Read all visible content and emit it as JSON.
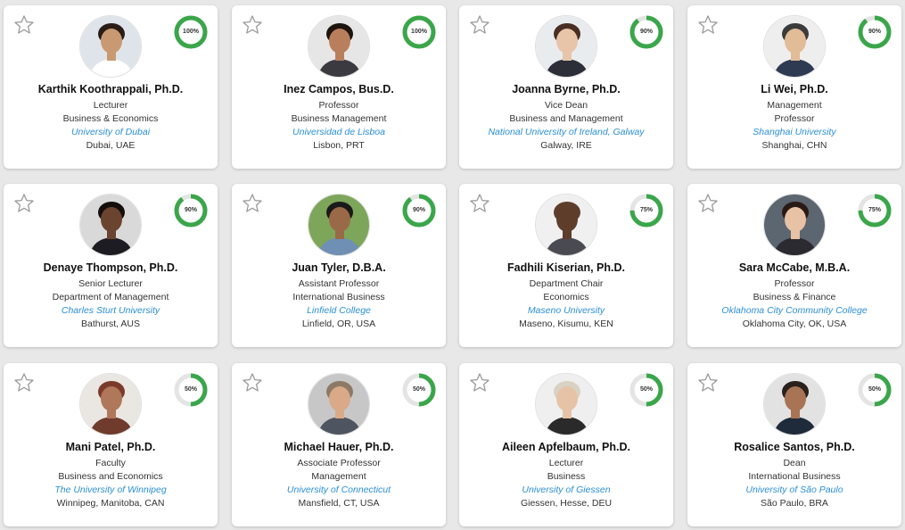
{
  "colors": {
    "ring_fill": "#3aa64a",
    "ring_track": "#e4e4e4",
    "link": "#2b8fd6"
  },
  "cards": [
    {
      "name": "Karthik Koothrappali, Ph.D.",
      "role": "Lecturer",
      "dept": "Business & Economics",
      "university": "University of Dubai",
      "location": "Dubai, UAE",
      "score": "100%",
      "score_value": 100,
      "skin": "#c99a72",
      "hair": "#2a1d16",
      "shirt": "#ffffff",
      "bg": "#dfe4ea"
    },
    {
      "name": "Inez Campos, Bus.D.",
      "role": "Professor",
      "dept": "Business Management",
      "university": "Universidad de Lisboa",
      "location": "Lisbon, PRT",
      "score": "100%",
      "score_value": 100,
      "skin": "#b97f5d",
      "hair": "#1e1410",
      "shirt": "#3a3a40",
      "bg": "#e6e6e6"
    },
    {
      "name": "Joanna Byrne, Ph.D.",
      "role": "Vice Dean",
      "dept": "Business and Management",
      "university": "National University of Ireland, Galway",
      "location": "Galway, IRE",
      "score": "90%",
      "score_value": 90,
      "skin": "#e8c4a8",
      "hair": "#4a2e22",
      "shirt": "#2c2f38",
      "bg": "#e9ecef"
    },
    {
      "name": "Li Wei, Ph.D.",
      "role": "Management",
      "dept": "Professor",
      "university": "Shanghai University",
      "location": "Shanghai, CHN",
      "score": "90%",
      "score_value": 90,
      "skin": "#e2bb97",
      "hair": "#3b3b3b",
      "shirt": "#2e3a52",
      "bg": "#eeeeee"
    },
    {
      "name": "Denaye Thompson, Ph.D.",
      "role": "Senior Lecturer",
      "dept": "Department of Management",
      "university": "Charles Sturt University",
      "location": "Bathurst, AUS",
      "score": "90%",
      "score_value": 90,
      "skin": "#6b4430",
      "hair": "#150f0c",
      "shirt": "#1c1c22",
      "bg": "#d9d9d9"
    },
    {
      "name": "Juan Tyler, D.B.A.",
      "role": "Assistant Professor",
      "dept": "International Business",
      "university": "Linfield College",
      "location": "Linfield, OR, USA",
      "score": "90%",
      "score_value": 90,
      "skin": "#9a6a48",
      "hair": "#1a1a1a",
      "shirt": "#6f8fb5",
      "bg": "#7ea65a"
    },
    {
      "name": "Fadhili Kiserian, Ph.D.",
      "role": "Department Chair",
      "dept": "Economics",
      "university": "Maseno University",
      "location": "Maseno, Kisumu, KEN",
      "score": "75%",
      "score_value": 75,
      "skin": "#5e3e2b",
      "hair": "#5e3e2b",
      "shirt": "#4a4a52",
      "bg": "#f0f0f0"
    },
    {
      "name": "Sara McCabe, M.B.A.",
      "role": "Professor",
      "dept": "Business & Finance",
      "university": "Oklahoma City Community College",
      "location": "Oklahoma City, OK, USA",
      "score": "75%",
      "score_value": 75,
      "skin": "#e8c2a4",
      "hair": "#2a1a14",
      "shirt": "#2a2a30",
      "bg": "#5c6670"
    },
    {
      "name": "Mani Patel, Ph.D.",
      "role": "Faculty",
      "dept": "Business and Economics",
      "university": "The University of Winnipeg",
      "location": "Winnipeg, Manitoba, CAN",
      "score": "50%",
      "score_value": 50,
      "skin": "#b0785a",
      "hair": "#7b3a2a",
      "shirt": "#6e3b2c",
      "bg": "#eae6e2"
    },
    {
      "name": "Michael Hauer, Ph.D.",
      "role": "Associate Professor",
      "dept": "Management",
      "university": "University of Connecticut",
      "location": "Mansfield, CT, USA",
      "score": "50%",
      "score_value": 50,
      "skin": "#d9a988",
      "hair": "#8c7a66",
      "shirt": "#4e5460",
      "bg": "#c7c7c7"
    },
    {
      "name": "Aileen Apfelbaum, Ph.D.",
      "role": "Lecturer",
      "dept": "Business",
      "university": "University of Giessen",
      "location": "Giessen, Hesse, DEU",
      "score": "50%",
      "score_value": 50,
      "skin": "#e6c3a6",
      "hair": "#d8d2c4",
      "shirt": "#2a2a2a",
      "bg": "#efefef"
    },
    {
      "name": "Rosalice Santos, Ph.D.",
      "role": "Dean",
      "dept": "International Business",
      "university": "University of São Paulo",
      "location": "São Paulo, BRA",
      "score": "50%",
      "score_value": 50,
      "skin": "#a87454",
      "hair": "#2a201c",
      "shirt": "#1f2a3a",
      "bg": "#e2e2e2"
    }
  ]
}
